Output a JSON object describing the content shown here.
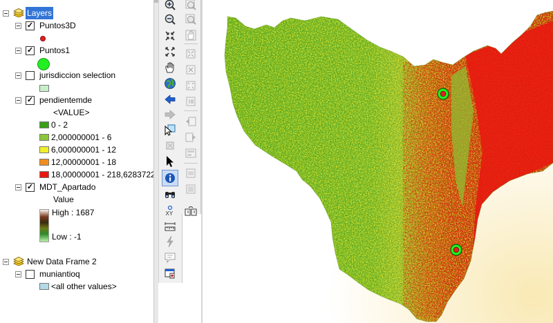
{
  "toc": {
    "data_frame_1": {
      "label": "Layers",
      "layers": [
        {
          "name": "Puntos3D",
          "checked": true,
          "symbol_color": "#e02020"
        },
        {
          "name": "Puntos1",
          "checked": true,
          "symbol_color": "#22ee22"
        },
        {
          "name": "jurisdiccion selection",
          "checked": false,
          "symbol_color": "#c8f0c8"
        },
        {
          "name": "pendientemde",
          "checked": true,
          "field_label": "<VALUE>",
          "classes": [
            {
              "label": "0 - 2",
              "color": "#3aa017"
            },
            {
              "label": "2,000000001 - 6",
              "color": "#8cc63a"
            },
            {
              "label": "6,000000001 - 12",
              "color": "#f0f02a"
            },
            {
              "label": "12,00000001 - 18",
              "color": "#f08c1e"
            },
            {
              "label": "18,00000001 - 218,6283722",
              "color": "#e8180f"
            }
          ]
        },
        {
          "name": "MDT_Apartado",
          "checked": true,
          "value_label": "Value",
          "high_label": "High : 1687",
          "low_label": "Low : -1"
        }
      ]
    },
    "data_frame_2": {
      "label": "New Data Frame 2",
      "layers": [
        {
          "name": "muniantioq",
          "checked": false,
          "value_label": "<all other values>",
          "symbol_color": "#b4d9e6"
        }
      ]
    }
  },
  "toolbar": {
    "tools_left": [
      "zoom-in-icon",
      "zoom-out-icon",
      "fixed-zoom-in-icon",
      "fixed-zoom-out-icon",
      "pan-icon",
      "full-extent-icon",
      "back-extent-icon",
      "forward-extent-icon",
      "select-features-icon",
      "clear-selection-icon",
      "select-elements-icon",
      "identify-icon",
      "find-icon",
      "go-to-xy-icon",
      "measure-icon",
      "hyperlink-icon",
      "html-popup-icon",
      "time-slider-icon"
    ],
    "tools_right": [
      "layout-zoom-in-icon",
      "layout-zoom-out-icon",
      "layout-pan-icon",
      "zoom-whole-page-icon",
      "zoom-100-icon",
      "layout-fixed-zoom-in-icon",
      "layout-fixed-zoom-out-icon",
      "layout-back-icon",
      "layout-forward-icon",
      "zoom-percent-icon",
      "toggle-draft-icon",
      "focus-data-frame-icon",
      "change-layout-icon"
    ],
    "xy_text": "XY"
  },
  "map": {
    "colors": {
      "low": "#3aa017",
      "mid": "#8cc63a",
      "yellow": "#f0f02a",
      "high": "#e8180f"
    },
    "points": [
      {
        "symbol": "point-marker-north"
      },
      {
        "symbol": "point-marker-south"
      }
    ]
  }
}
